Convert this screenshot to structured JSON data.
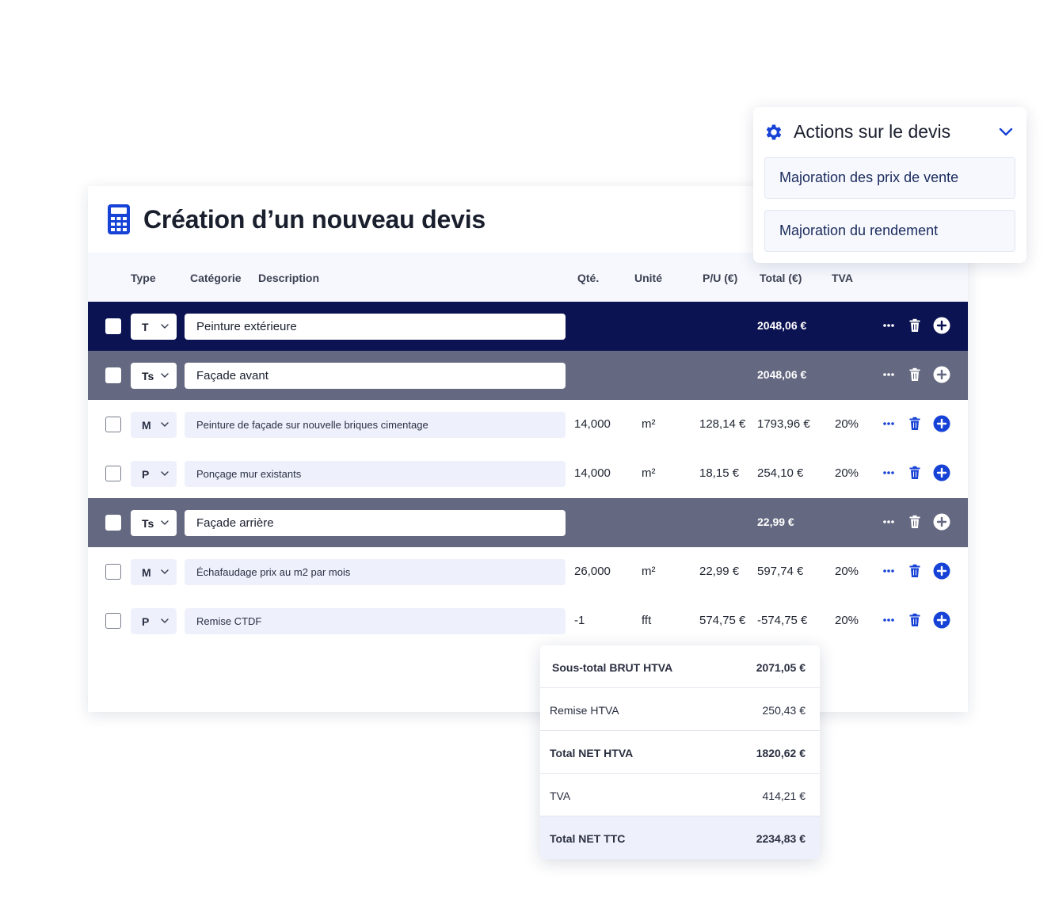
{
  "page": {
    "title": "Création d’un nouveau devis"
  },
  "columns": {
    "type": "Type",
    "category": "Catégorie",
    "description": "Description",
    "qty": "Qté.",
    "unit": "Unité",
    "pu": "P/U (€)",
    "total": "Total (€)",
    "tva": "TVA"
  },
  "rows": [
    {
      "kind": "T",
      "type": "T",
      "description": "Peinture extérieure",
      "qty": "",
      "unit": "",
      "pu": "",
      "total": "2048,06 €",
      "tva": ""
    },
    {
      "kind": "Ts",
      "type": "Ts",
      "description": "Façade avant",
      "qty": "",
      "unit": "",
      "pu": "",
      "total": "2048,06 €",
      "tva": ""
    },
    {
      "kind": "item",
      "type": "M",
      "description": "Peinture de façade sur nouvelle briques cimentage",
      "qty": "14,000",
      "unit": "m²",
      "pu": "128,14 €",
      "total": "1793,96 €",
      "tva": "20%"
    },
    {
      "kind": "item",
      "type": "P",
      "description": "Ponçage mur existants",
      "qty": "14,000",
      "unit": "m²",
      "pu": "18,15 €",
      "total": "254,10 €",
      "tva": "20%"
    },
    {
      "kind": "Ts",
      "type": "Ts",
      "description": "Façade arrière",
      "qty": "",
      "unit": "",
      "pu": "",
      "total": "22,99 €",
      "tva": ""
    },
    {
      "kind": "item",
      "type": "M",
      "description": "Échafaudage prix au m2 par mois",
      "qty": "26,000",
      "unit": "m²",
      "pu": "22,99 €",
      "total": "597,74 €",
      "tva": "20%"
    },
    {
      "kind": "item",
      "type": "P",
      "description": "Remise CTDF",
      "qty": "-1",
      "unit": "fft",
      "pu": "574,75 €",
      "total": "-574,75 €",
      "tva": "20%"
    }
  ],
  "actions": {
    "title": "Actions sur le devis",
    "items": [
      "Majoration des prix de vente",
      "Majoration du rendement"
    ]
  },
  "totals": [
    {
      "label": "Sous-total BRUT HTVA",
      "value": "2071,05 €",
      "bold": true
    },
    {
      "label": "Remise HTVA",
      "value": "250,43 €",
      "bold": false
    },
    {
      "label": "Total NET HTVA",
      "value": "1820,62 €",
      "bold": true
    },
    {
      "label": "TVA",
      "value": "414,21 €",
      "bold": false
    },
    {
      "label": "Total NET TTC",
      "value": "2234,83 €",
      "bold": true
    }
  ],
  "colors": {
    "accent": "#1742d6",
    "row_t": "#0c1352",
    "row_ts": "#646880"
  }
}
